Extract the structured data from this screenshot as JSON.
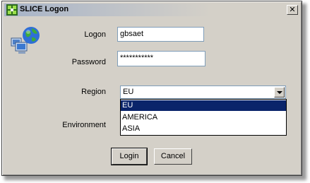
{
  "window": {
    "title": "SLICE Logon",
    "close_label": "✕"
  },
  "form": {
    "logon_label": "Logon",
    "logon_value": "gbsaet",
    "password_label": "Password",
    "password_value": "***********",
    "region_label": "Region",
    "region_selected": "EU",
    "environment_label": "Environment"
  },
  "region_options": [
    "EU",
    "AMERICA",
    "ASIA"
  ],
  "buttons": {
    "login": "Login",
    "cancel": "Cancel"
  },
  "icons": {
    "title": "slice-logo-icon",
    "app": "network-computer-globe-icon",
    "dropdown": "chevron-down-icon"
  }
}
